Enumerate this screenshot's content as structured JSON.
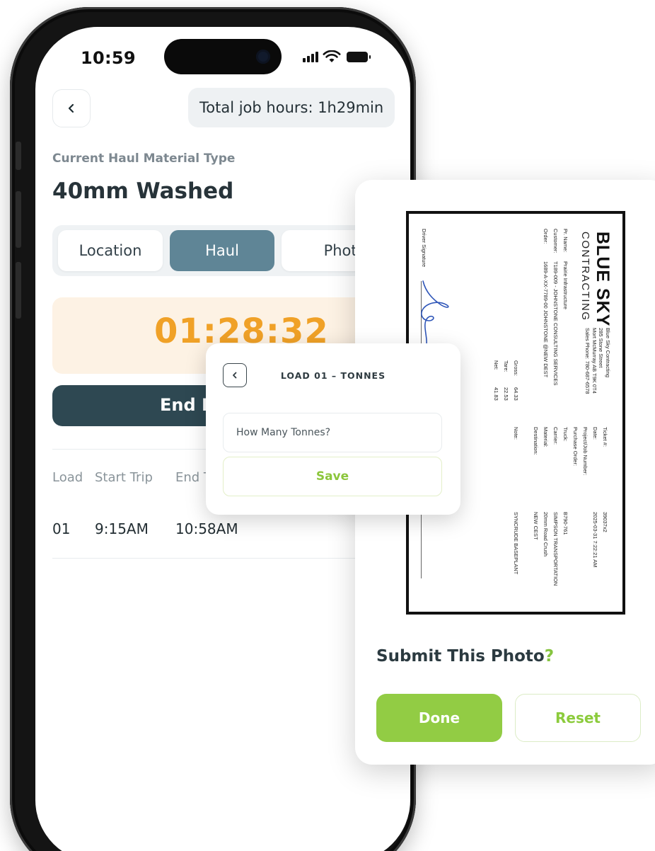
{
  "status_bar": {
    "time": "10:59"
  },
  "header": {
    "total_hours": "Total job hours: 1h29min"
  },
  "material": {
    "label": "Current Haul Material Type",
    "value": "40mm Washed"
  },
  "tabs": [
    {
      "label": "Location",
      "active": false
    },
    {
      "label": "Haul",
      "active": true
    },
    {
      "label": "Photos",
      "active": false
    }
  ],
  "timer": {
    "value": "01:28:32"
  },
  "end_button": {
    "label": "End H"
  },
  "loads_table": {
    "headers": [
      "Load",
      "Start Trip",
      "End Tr"
    ],
    "rows": [
      {
        "load": "01",
        "start": "9:15AM",
        "end": "10:58AM"
      }
    ]
  },
  "tonnes_modal": {
    "title": "LOAD 01 – TONNES",
    "input_placeholder": "How Many Tonnes?",
    "save_label": "Save"
  },
  "ticket": {
    "brand": "BLUE SKY",
    "brand_sub": "CONTRACTING",
    "address": [
      "Blue Sky Contracting",
      "285 Stone Street",
      "Mort McMurray AB T9K 0T4",
      "Sales Phone: 780-687-6578"
    ],
    "pr_name_label": "Pr. Name:",
    "pr_name": "Prairie Infrastructure",
    "customer_label": "Customer:",
    "customer": "T189-009 - JOHNSTONE CONSULTING SERVICES",
    "order_label": "Order:",
    "order": "1689-A-XX-7789-00 JOHNSTONE @NEW DEST",
    "gross_label": "Gross:",
    "gross": "64.33",
    "tare_label": "Tare:",
    "tare": "22.53",
    "net_label": "Net:",
    "net": "41.83",
    "ticket_label": "Ticket #:",
    "ticket_no": "39037x2",
    "date_label": "Date:",
    "date": "2025-03-31  7:22:21 AM",
    "project_label": "Project/Job Number:",
    "po_label": "Purchase Order:",
    "truck_label": "Truck:",
    "truck": "B790-761",
    "carrier_label": "Carrier:",
    "carrier": "SIMPSON TRANSPORTATION",
    "material_label": "Material:",
    "material": "20mm Road Crush",
    "destination_label": "Destination:",
    "destination": "NEW CEST",
    "note_label": "Note:",
    "note": "SYNCRUDE BASEPLANT",
    "signature_label": "Driver Signature"
  },
  "submit": {
    "question": "Submit This Photo",
    "question_mark": "?",
    "done_label": "Done",
    "reset_label": "Reset"
  },
  "colors": {
    "tab_active": "#5f8596",
    "timer_text": "#f0a127",
    "timer_bg": "#fdf2e4",
    "end_button": "#2e4852",
    "accent_green": "#92cc44"
  }
}
